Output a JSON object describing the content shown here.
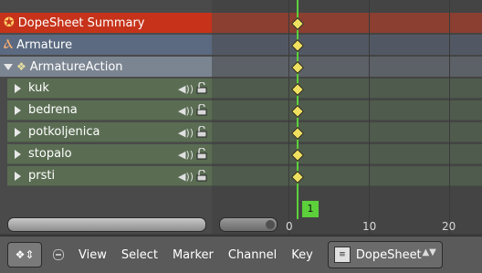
{
  "channels": {
    "summary_label": "DopeSheet Summary",
    "armature_label": "Armature",
    "action_label": "ArmatureAction",
    "bones": [
      {
        "label": "kuk"
      },
      {
        "label": "bedrena"
      },
      {
        "label": "potkoljenica"
      },
      {
        "label": "stopalo"
      },
      {
        "label": "prsti"
      }
    ]
  },
  "timeline": {
    "current_frame": "1",
    "ticks": [
      "0",
      "10",
      "20"
    ]
  },
  "header": {
    "menus": [
      "View",
      "Select",
      "Marker",
      "Channel",
      "Key"
    ],
    "mode_label": "DopeSheet"
  },
  "colors": {
    "summary": "#c6331a",
    "playhead": "#5cd03b",
    "keyframe": "#f0e060",
    "bone_row": "#5a6d53"
  }
}
